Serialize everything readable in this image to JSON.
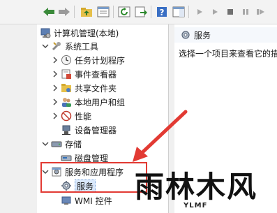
{
  "tree": {
    "root": "计算机管理(本地)",
    "system_tools": "系统工具",
    "task_scheduler": "任务计划程序",
    "event_viewer": "事件查看器",
    "shared_folders": "共享文件夹",
    "local_users": "本地用户和组",
    "performance": "性能",
    "device_manager": "设备管理器",
    "storage": "存储",
    "disk_management": "磁盘管理",
    "services_apps": "服务和应用程序",
    "services": "服务",
    "wmi_control": "WMI 控件"
  },
  "pane": {
    "title": "服务",
    "hint": "选择一个项目来查看它的描"
  },
  "watermark": {
    "text": "雨林木风",
    "sub": "YLMF"
  },
  "colors": {
    "highlight": "#e23a33",
    "selection": "#d9e8fb",
    "desktop": "#3f78b9"
  }
}
